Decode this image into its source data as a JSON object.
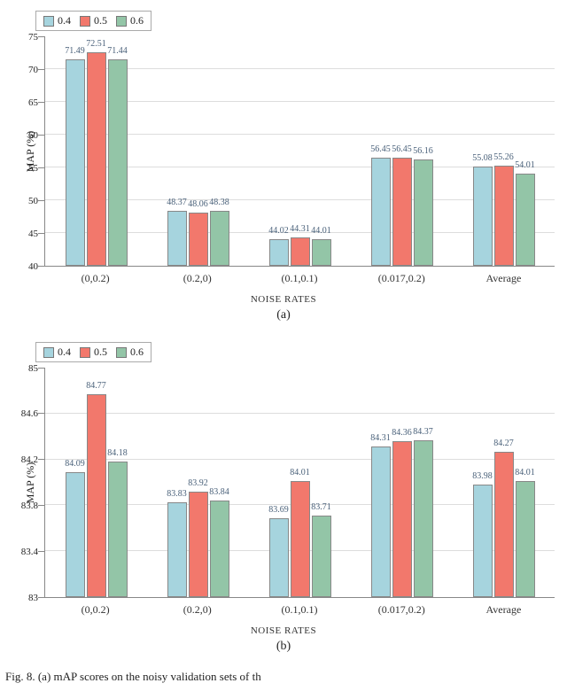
{
  "legend": {
    "s04": "0.4",
    "s05": "0.5",
    "s06": "0.6"
  },
  "chart_a": {
    "ylabel": "MAP (%)",
    "xlabel": "NOISE RATES",
    "subcap": "(a)",
    "ylim": [
      40,
      75
    ],
    "categories": [
      "(0,0.2)",
      "(0.2,0)",
      "(0.1,0.1)",
      "(0.017,0.2)",
      "Average"
    ],
    "series": [
      {
        "name": "0.4",
        "color": "c04",
        "values": [
          71.49,
          48.37,
          44.02,
          56.45,
          55.08
        ]
      },
      {
        "name": "0.5",
        "color": "c05",
        "values": [
          72.51,
          48.06,
          44.31,
          56.45,
          55.26
        ]
      },
      {
        "name": "0.6",
        "color": "c06",
        "values": [
          71.44,
          48.38,
          44.01,
          56.16,
          54.01
        ]
      }
    ]
  },
  "chart_b": {
    "ylabel": "MAP (%)",
    "xlabel": "NOISE RATES",
    "subcap": "(b)",
    "ylim": [
      83,
      85
    ],
    "categories": [
      "(0,0.2)",
      "(0.2,0)",
      "(0.1,0.1)",
      "(0.017,0.2)",
      "Average"
    ],
    "series": [
      {
        "name": "0.4",
        "color": "c04",
        "values": [
          84.09,
          83.83,
          83.69,
          84.31,
          83.98
        ]
      },
      {
        "name": "0.5",
        "color": "c05",
        "values": [
          84.77,
          83.92,
          84.01,
          84.36,
          84.27
        ]
      },
      {
        "name": "0.6",
        "color": "c06",
        "values": [
          84.18,
          83.84,
          83.71,
          84.37,
          84.01
        ]
      }
    ]
  },
  "ticks_a": [
    "40",
    "45",
    "50",
    "55",
    "60",
    "65",
    "70",
    "75"
  ],
  "ticks_b": [
    "83",
    "83.4",
    "83.8",
    "84.2",
    "84.6",
    "85"
  ],
  "chart_data": [
    {
      "type": "bar",
      "title": "",
      "xlabel": "NOISE RATES",
      "ylabel": "MAP (%)",
      "ylim": [
        40,
        75
      ],
      "categories": [
        "(0,0.2)",
        "(0.2,0)",
        "(0.1,0.1)",
        "(0.017,0.2)",
        "Average"
      ],
      "series": [
        {
          "name": "0.4",
          "values": [
            71.49,
            48.37,
            44.02,
            56.45,
            55.08
          ]
        },
        {
          "name": "0.5",
          "values": [
            72.51,
            48.06,
            44.31,
            56.45,
            55.26
          ]
        },
        {
          "name": "0.6",
          "values": [
            71.44,
            48.38,
            44.01,
            56.16,
            54.01
          ]
        }
      ]
    },
    {
      "type": "bar",
      "title": "",
      "xlabel": "NOISE RATES",
      "ylabel": "MAP (%)",
      "ylim": [
        83,
        85
      ],
      "categories": [
        "(0,0.2)",
        "(0.2,0)",
        "(0.1,0.1)",
        "(0.017,0.2)",
        "Average"
      ],
      "series": [
        {
          "name": "0.4",
          "values": [
            84.09,
            83.83,
            83.69,
            84.31,
            83.98
          ]
        },
        {
          "name": "0.5",
          "values": [
            84.77,
            83.92,
            84.01,
            84.36,
            84.27
          ]
        },
        {
          "name": "0.6",
          "values": [
            84.18,
            83.84,
            83.71,
            84.37,
            84.01
          ]
        }
      ]
    }
  ],
  "figcaption_prefix": "Fig. 8.  (a)  mAP  scores  on  the  noisy  validation  sets  of  th"
}
